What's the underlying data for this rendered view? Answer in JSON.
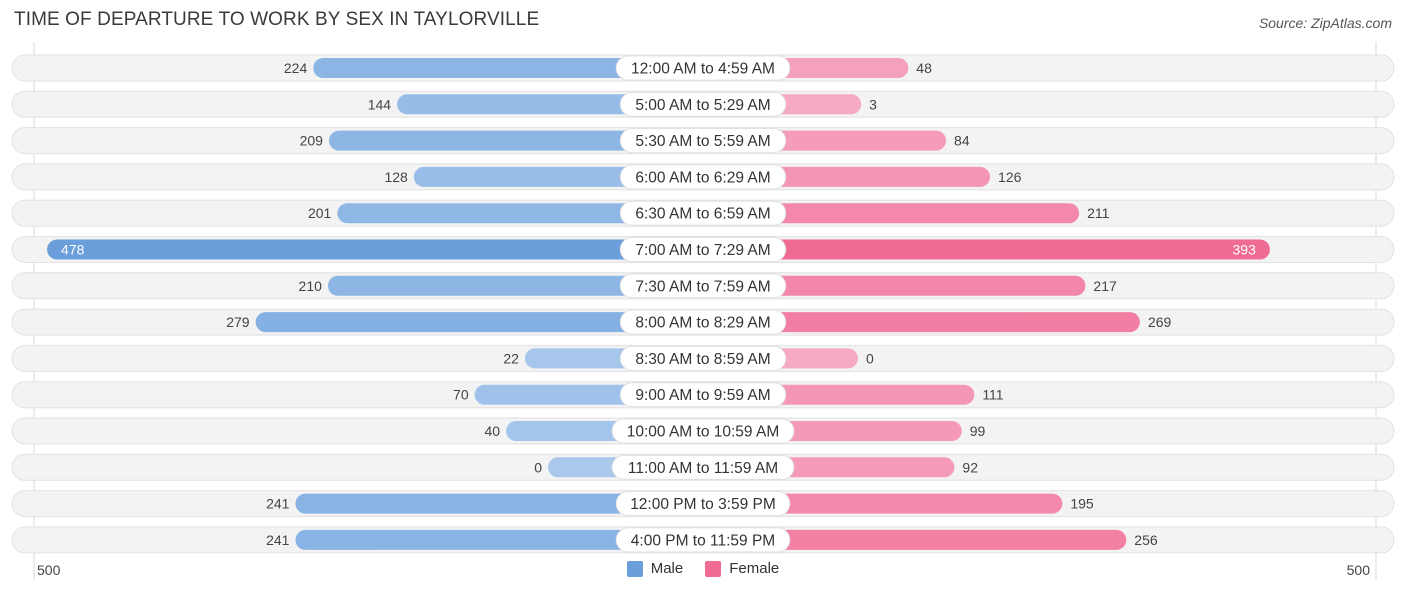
{
  "header": {
    "title": "TIME OF DEPARTURE TO WORK BY SEX IN TAYLORVILLE",
    "source": "Source: ZipAtlas.com"
  },
  "colors": {
    "male": "#6a9fdc",
    "male_light": "#a9c8ec",
    "female": "#f06b94",
    "female_light": "#f6a9c3",
    "row_bg": "#f3f3f3"
  },
  "chart_data": {
    "type": "bar",
    "orientation": "horizontal-diverging",
    "title": "TIME OF DEPARTURE TO WORK BY SEX IN TAYLORVILLE",
    "categories": [
      "12:00 AM to 4:59 AM",
      "5:00 AM to 5:29 AM",
      "5:30 AM to 5:59 AM",
      "6:00 AM to 6:29 AM",
      "6:30 AM to 6:59 AM",
      "7:00 AM to 7:29 AM",
      "7:30 AM to 7:59 AM",
      "8:00 AM to 8:29 AM",
      "8:30 AM to 8:59 AM",
      "9:00 AM to 9:59 AM",
      "10:00 AM to 10:59 AM",
      "11:00 AM to 11:59 AM",
      "12:00 PM to 3:59 PM",
      "4:00 PM to 11:59 PM"
    ],
    "series": [
      {
        "name": "Male",
        "values": [
          224,
          144,
          209,
          128,
          201,
          478,
          210,
          279,
          22,
          70,
          40,
          0,
          241,
          241
        ]
      },
      {
        "name": "Female",
        "values": [
          48,
          3,
          84,
          126,
          211,
          393,
          217,
          269,
          0,
          111,
          99,
          92,
          195,
          256
        ]
      }
    ],
    "xlim": [
      -500,
      500
    ],
    "axis_labels": {
      "left": "500",
      "right": "500"
    },
    "legend": {
      "placement": "bottom-center",
      "entries": [
        "Male",
        "Female"
      ]
    },
    "grid": false
  }
}
